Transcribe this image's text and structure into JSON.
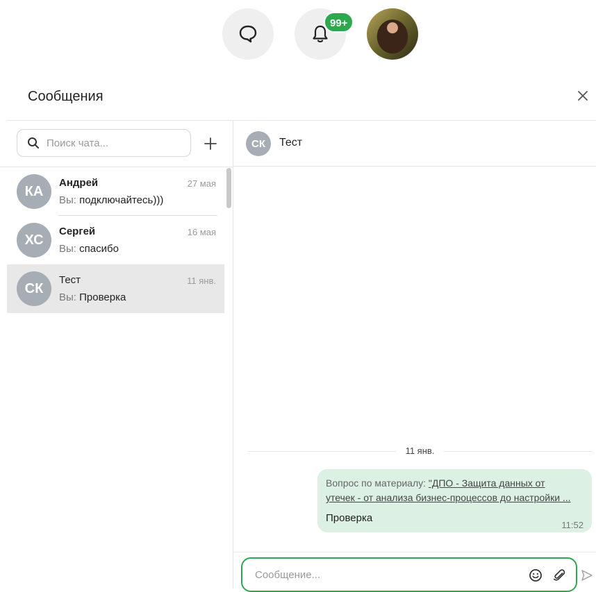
{
  "topbar": {
    "notifications_badge": "99+"
  },
  "panel": {
    "title": "Сообщения"
  },
  "search": {
    "placeholder": "Поиск чата..."
  },
  "chats": [
    {
      "initials": "КА",
      "name": "Андрей",
      "date": "27 мая",
      "you": "Вы:",
      "message": "подключайтесь)))"
    },
    {
      "initials": "ХС",
      "name": "Сергей",
      "date": "16 мая",
      "you": "Вы:",
      "message": "спасибо"
    },
    {
      "initials": "СК",
      "name": "Тест",
      "date": "11 янв.",
      "you": "Вы:",
      "message": "Проверка"
    }
  ],
  "active_chat": {
    "initials": "СК",
    "name": "Тест",
    "date_separator": "11 янв.",
    "message": {
      "question_prefix": "Вопрос по материалу:",
      "link_line1": "\"ДПО - Защита данных от",
      "link_line2": "утечек - от анализа бизнес-процессов до настройки ...",
      "text": "Проверка",
      "time": "11:52"
    }
  },
  "composer": {
    "placeholder": "Сообщение..."
  },
  "colors": {
    "accent": "#2ea84f",
    "bubble": "#dcf1e3",
    "avatar": "#a7adb5"
  }
}
